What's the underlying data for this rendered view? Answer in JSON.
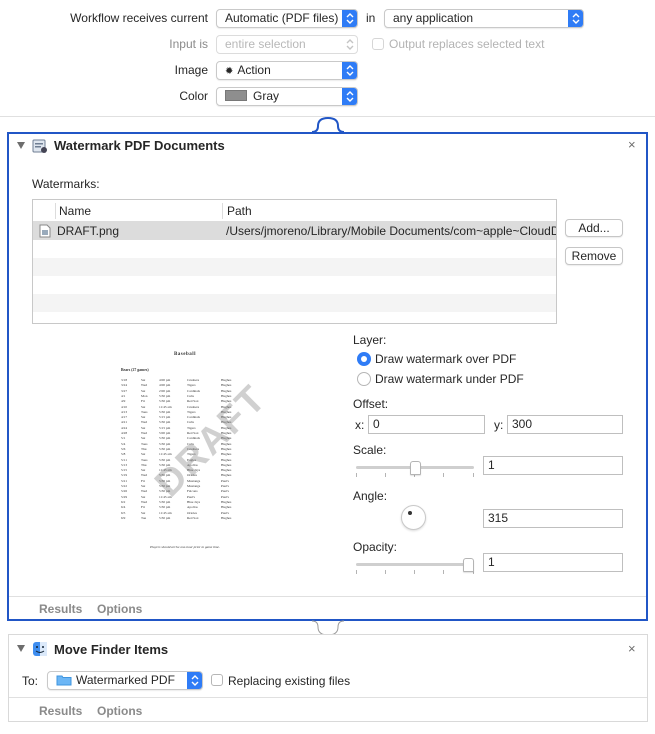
{
  "workflow": {
    "receives_label": "Workflow receives current",
    "receives_value": "Automatic (PDF files)",
    "in_label": "in",
    "in_value": "any application",
    "input_is_label": "Input is",
    "input_is_value": "entire selection",
    "output_replaces_label": "Output replaces selected text",
    "image_label": "Image",
    "image_value": "Action",
    "color_label": "Color",
    "color_value": "Gray",
    "color_swatch": "#8e8e8e",
    "accent": "#2f7cf6"
  },
  "watermark_action": {
    "title": "Watermark PDF Documents",
    "watermarks_label": "Watermarks:",
    "columns": {
      "name": "Name",
      "path": "Path"
    },
    "rows": [
      {
        "name": "DRAFT.png",
        "path": "/Users/jmoreno/Library/Mobile Documents/com~apple~CloudD"
      }
    ],
    "add_button": "Add...",
    "remove_button": "Remove",
    "layer_label": "Layer:",
    "layer_options": [
      "Draw watermark over PDF",
      "Draw watermark under PDF"
    ],
    "layer_selected": 0,
    "offset_label": "Offset:",
    "offset_x_label": "x:",
    "offset_x": "0",
    "offset_y_label": "y:",
    "offset_y": "300",
    "scale_label": "Scale:",
    "scale_value": "1",
    "scale_level": 0.5,
    "angle_label": "Angle:",
    "angle_value": "315",
    "opacity_label": "Opacity:",
    "opacity_value": "1",
    "opacity_level": 1.0,
    "tabs": [
      "Results",
      "Options"
    ],
    "preview": {
      "heading": "Baseball",
      "subheading": "Bears (27 games)",
      "watermark_text": "DRAFT",
      "footer": "Players should arrive one-hour prior to game time.",
      "rows": [
        [
          "3/18",
          "Sat",
          "4:00 pm",
          "Crushers",
          "Hughes"
        ],
        [
          "3/24",
          "Wed",
          "4:00 pm",
          "Tigers",
          "Hughes"
        ],
        [
          "3/27",
          "Sat",
          "2:00 pm",
          "Cardinals",
          "Hughes"
        ],
        [
          "4/1",
          "Mon",
          "5:30 pm",
          "Cubs",
          "Hughes"
        ],
        [
          "4/9",
          "Fri",
          "5:30 pm",
          "Red Sox",
          "Hughes"
        ],
        [
          "4/10",
          "Sat",
          "11:45 am",
          "Crushers",
          "Hughes"
        ],
        [
          "4/13",
          "Tues",
          "5:30 pm",
          "Tigers",
          "Hughes"
        ],
        [
          "4/17",
          "Sat",
          "5:15 pm",
          "Cardinals",
          "Hughes"
        ],
        [
          "4/21",
          "Wed",
          "5:30 pm",
          "Cubs",
          "Hughes"
        ],
        [
          "4/24",
          "Sat",
          "5:15 pm",
          "Tigers",
          "Hughes"
        ],
        [
          "4/28",
          "Wed",
          "5:00 pm",
          "Red Sox",
          "Hughes"
        ],
        [
          "5/1",
          "Sat",
          "5:30 pm",
          "Cardinals",
          "Hughes"
        ],
        [
          "5/4",
          "Tues",
          "5:30 pm",
          "Cubs",
          "Hughes"
        ],
        [
          "5/6",
          "Thu",
          "5:30 pm",
          "Crushers",
          "Hughes"
        ],
        [
          "5/8",
          "Sat",
          "11:45 am",
          "Tigers",
          "Hughes"
        ],
        [
          "5/11",
          "Tues",
          "5:30 pm",
          "Eagles",
          "Hughes"
        ],
        [
          "5/13",
          "Thu",
          "5:30 pm",
          "Apollos",
          "Hughes"
        ],
        [
          "5/15",
          "Sat",
          "11:45 am",
          "Blue Jays",
          "Hughes"
        ],
        [
          "5/19",
          "Wed",
          "5:30 pm",
          "Orioles",
          "Hughes"
        ],
        [
          "5/21",
          "Fri",
          "5:30 pm",
          "Mustangs",
          "Paul's"
        ],
        [
          "5/22",
          "Sat",
          "5:30 pm",
          "Mustangs",
          "Paul's"
        ],
        [
          "5/26",
          "Wed",
          "5:30 pm",
          "Falcons",
          "Paul's"
        ],
        [
          "5/29",
          "Sat",
          "11:45 am",
          "Paul's",
          "Paul's"
        ],
        [
          "6/2",
          "Wed",
          "5:30 pm",
          "Blue Jays",
          "Hughes"
        ],
        [
          "6/4",
          "Fri",
          "5:30 pm",
          "Apollos",
          "Hughes"
        ],
        [
          "6/5",
          "Sat",
          "11:45 am",
          "Orioles",
          "Paul's"
        ],
        [
          "6/9",
          "Tue",
          "5:30 pm",
          "Red Sox",
          "Hughes"
        ]
      ]
    }
  },
  "move_action": {
    "title": "Move Finder Items",
    "to_label": "To:",
    "to_value": "Watermarked PDF",
    "replacing_label": "Replacing existing files",
    "tabs": [
      "Results",
      "Options"
    ]
  }
}
